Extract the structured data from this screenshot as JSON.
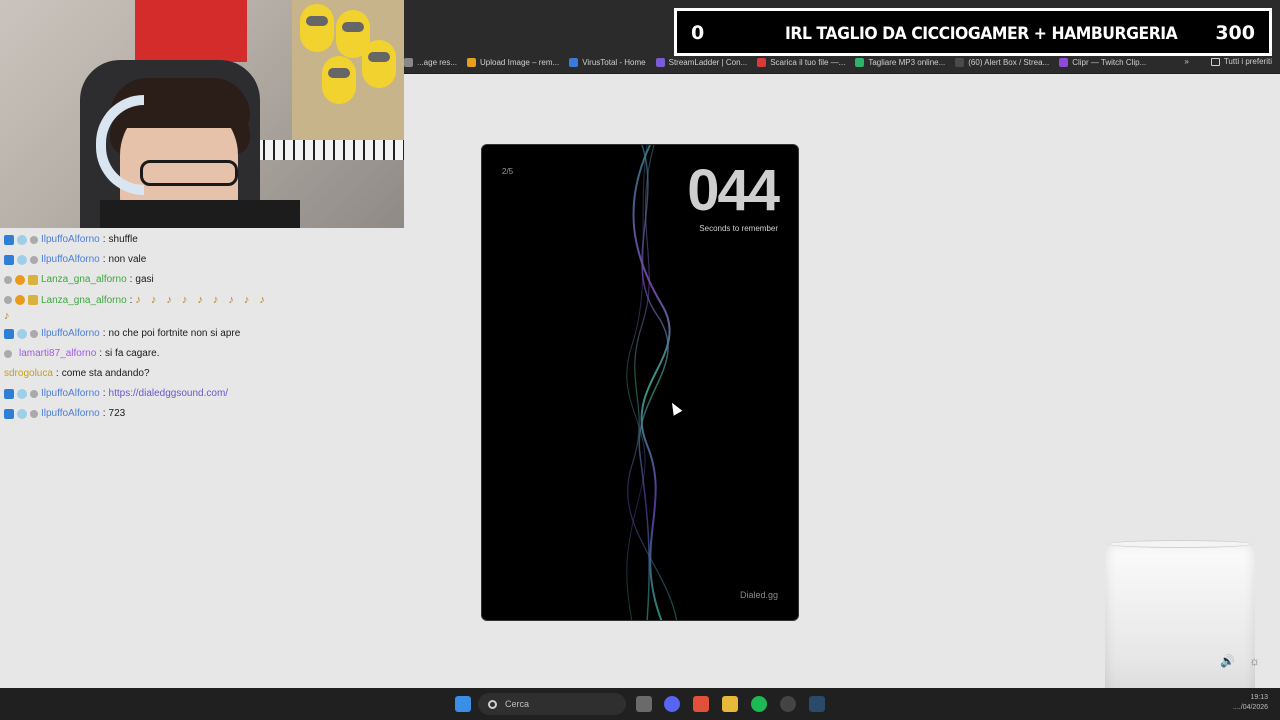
{
  "banner": {
    "left_count": "0",
    "title": "IRL TAGLIO DA CICCIOGAMER + HAMBURGERIA",
    "goal": "300"
  },
  "bookmarks": [
    {
      "label": "...age res...",
      "color": "#888888"
    },
    {
      "label": "Upload Image – rem...",
      "color": "#e6a020"
    },
    {
      "label": "VirusTotal - Home",
      "color": "#3b7ad8"
    },
    {
      "label": "StreamLadder | Con...",
      "color": "#7a5cd6"
    },
    {
      "label": "Scarica il tuo file —...",
      "color": "#d83a3a"
    },
    {
      "label": "Tagliare MP3 online...",
      "color": "#2fb36a"
    },
    {
      "label": "(60) Alert Box / Strea...",
      "color": "#4a4a4a"
    },
    {
      "label": "Clipr — Twitch Clip...",
      "color": "#8e4ad8"
    }
  ],
  "bookmarks_more": "»",
  "bookmarks_folder": "Tutti i preferiti",
  "chat": [
    {
      "user": "IlpuffoAlforno",
      "color": "blue",
      "text": "shuffle",
      "badges": [
        "blue",
        "light",
        "gray"
      ]
    },
    {
      "user": "IlpuffoAlforno",
      "color": "blue",
      "text": "non vale",
      "badges": [
        "blue",
        "light",
        "gray"
      ]
    },
    {
      "user": "Lanza_gna_alforno",
      "color": "green",
      "text": "gasi",
      "badges": [
        "gray",
        "orange",
        "gold"
      ]
    },
    {
      "user": "Lanza_gna_alforno",
      "color": "green",
      "text": "",
      "emotes": 9,
      "badges": [
        "gray",
        "orange",
        "gold"
      ]
    },
    {
      "user": "IlpuffoAlforno",
      "color": "blue",
      "text": "no che poi fortnite non si apre",
      "badges": [
        "blue",
        "light",
        "gray"
      ]
    },
    {
      "user": "lamarti87_alforno",
      "color": "purple",
      "text": "si fa cagare.",
      "badges": [
        "gray"
      ]
    },
    {
      "user": "sdrogoluca",
      "color": "yellow",
      "text": "come sta andando?",
      "badges": []
    },
    {
      "user": "IlpuffoAlforno",
      "color": "blue",
      "text": "https://dialedggsound.com/",
      "link": true,
      "badges": [
        "blue",
        "light",
        "gray"
      ]
    },
    {
      "user": "IlpuffoAlforno",
      "color": "blue",
      "text": "723",
      "badges": [
        "blue",
        "light",
        "gray"
      ]
    }
  ],
  "game": {
    "round": "2/5",
    "countdown": "044",
    "countdown_label": "Seconds to remember",
    "brand": "Dialed.gg"
  },
  "taskbar": {
    "search_placeholder": "Cerca",
    "time": "19:13",
    "date": "..../04/2026"
  }
}
